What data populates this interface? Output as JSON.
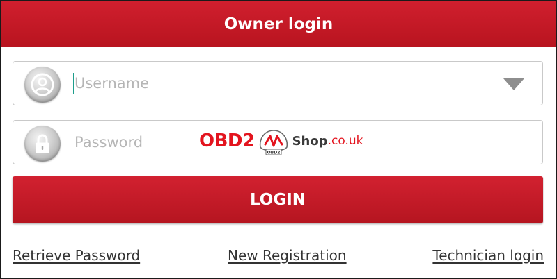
{
  "header": {
    "title": "Owner login"
  },
  "username": {
    "placeholder": "Username",
    "icon": "user-icon"
  },
  "password": {
    "placeholder": "Password",
    "icon": "lock-icon"
  },
  "login_button": {
    "label": "LOGIN"
  },
  "links": {
    "retrieve": "Retrieve Password",
    "register": "New Registration",
    "technician": "Technician login"
  },
  "watermark": {
    "brand": "OBD2",
    "badge": "OBD2",
    "shop": "Shop",
    "tld": ".co.uk"
  },
  "colors": {
    "accent": "#c8192a",
    "caret": "#1e9e8c",
    "watermark_red": "#e3141e"
  }
}
